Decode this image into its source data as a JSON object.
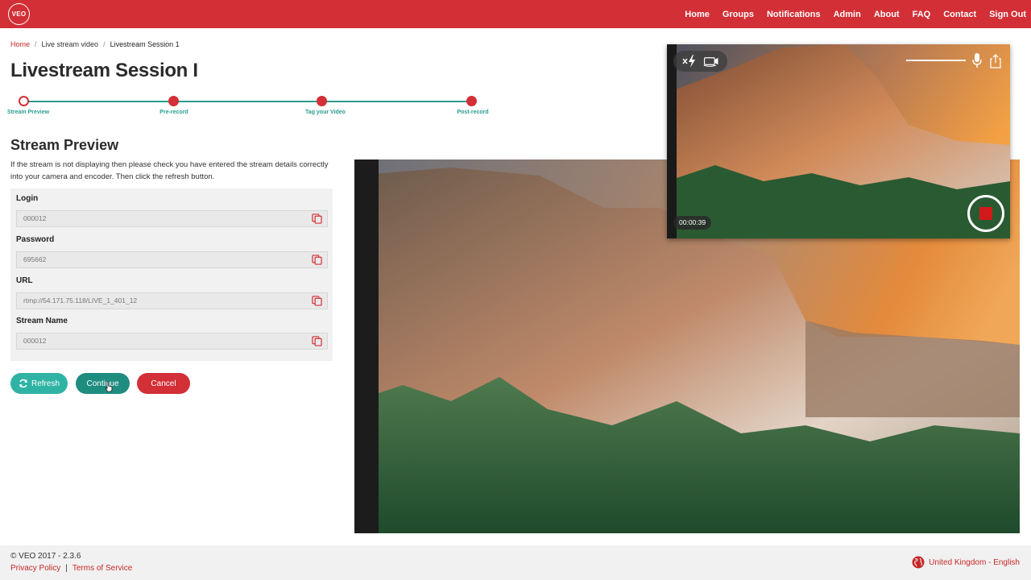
{
  "navbar": {
    "logo_text": "VEO",
    "links": [
      "Home",
      "Groups",
      "Notifications",
      "Admin",
      "About",
      "FAQ",
      "Contact",
      "Sign Out"
    ]
  },
  "breadcrumb": {
    "home": "Home",
    "parent": "Live stream video",
    "current": "Livestream Session 1"
  },
  "page_title": "Livestream Session I",
  "stepper": {
    "steps": [
      "Stream Preview",
      "Pre-record",
      "Tag your Video",
      "Post-record"
    ],
    "current_index": 0
  },
  "section": {
    "title": "Stream Preview",
    "description": "If the stream is not displaying then please check you have entered the stream details correctly into your camera and encoder. Then click the refresh button."
  },
  "form": {
    "fields": [
      {
        "label": "Login",
        "value": "000012"
      },
      {
        "label": "Password",
        "value": "695662"
      },
      {
        "label": "URL",
        "value": "rtmp://54.171.75.118/LIVE_1_401_12"
      },
      {
        "label": "Stream Name",
        "value": "000012"
      }
    ]
  },
  "buttons": {
    "refresh": "Refresh",
    "continue": "Continue",
    "cancel": "Cancel"
  },
  "video_pip": {
    "timer": "00:00:39",
    "icons": [
      "flash-off-icon",
      "switch-camera-icon",
      "microphone-icon",
      "share-icon",
      "record-icon"
    ]
  },
  "footer": {
    "copyright": "© VEO 2017 - 2.3.6",
    "privacy": "Privacy Policy",
    "separator": "|",
    "terms": "Terms of Service",
    "locale": "United Kingdom - English"
  },
  "colors": {
    "brand_red": "#d32f36",
    "teal": "#2a9d8f",
    "teal_button": "#2fb3a4",
    "teal_dark_button": "#1f8c80"
  }
}
